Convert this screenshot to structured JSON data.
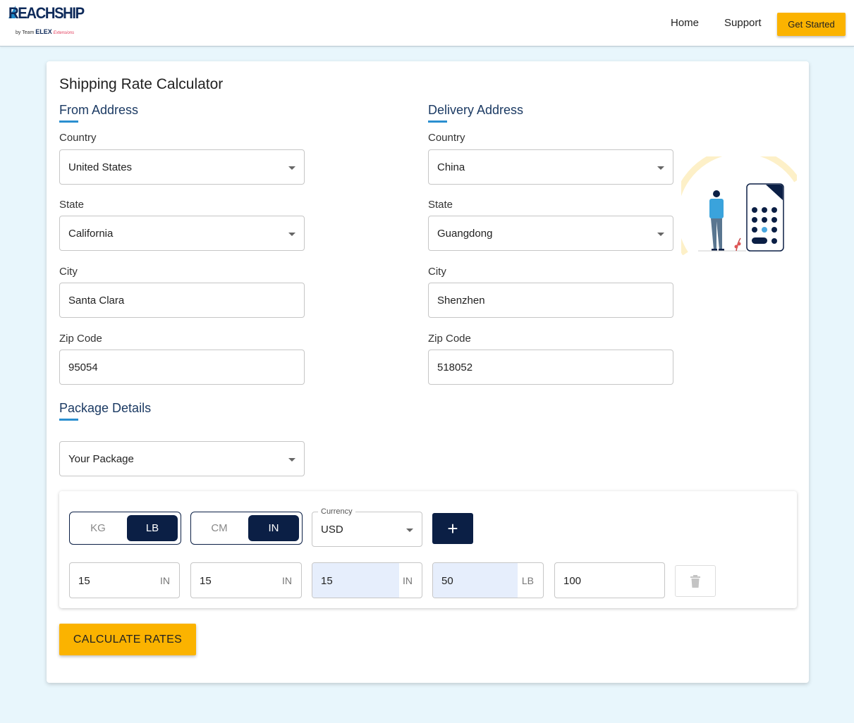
{
  "header": {
    "brand": "REACHSHIP",
    "byline_prefix": "by Team",
    "byline_brand": "ELEX",
    "byline_suffix": "Extensions",
    "nav": {
      "home": "Home",
      "support": "Support"
    },
    "cta": "Get Started"
  },
  "page_title": "Shipping Rate Calculator",
  "from": {
    "title": "From Address",
    "country_label": "Country",
    "country": "United States",
    "state_label": "State",
    "state": "California",
    "city_label": "City",
    "city": "Santa Clara",
    "zip_label": "Zip Code",
    "zip": "95054"
  },
  "delivery": {
    "title": "Delivery Address",
    "country_label": "Country",
    "country": "China",
    "state_label": "State",
    "state": "Guangdong",
    "city_label": "City",
    "city": "Shenzhen",
    "zip_label": "Zip Code",
    "zip": "518052"
  },
  "package": {
    "title": "Package Details",
    "selected": "Your Package",
    "weight_unit": {
      "off": "KG",
      "on": "LB"
    },
    "dim_unit": {
      "off": "CM",
      "on": "IN"
    },
    "currency_label": "Currency",
    "currency": "USD",
    "add_label": "+",
    "length": {
      "value": "15",
      "unit": "IN"
    },
    "width": {
      "value": "15",
      "unit": "IN"
    },
    "height": {
      "value": "15",
      "unit": "IN"
    },
    "weight": {
      "value": "50",
      "unit": "LB"
    },
    "insured_value": "100"
  },
  "calculate_label": "CALCULATE RATES",
  "colors": {
    "accent": "#fbb300",
    "navy": "#0b1f45",
    "heading": "#1b3a63"
  },
  "icons": {
    "delete": "trash-icon",
    "dropdown": "caret-down-icon"
  }
}
